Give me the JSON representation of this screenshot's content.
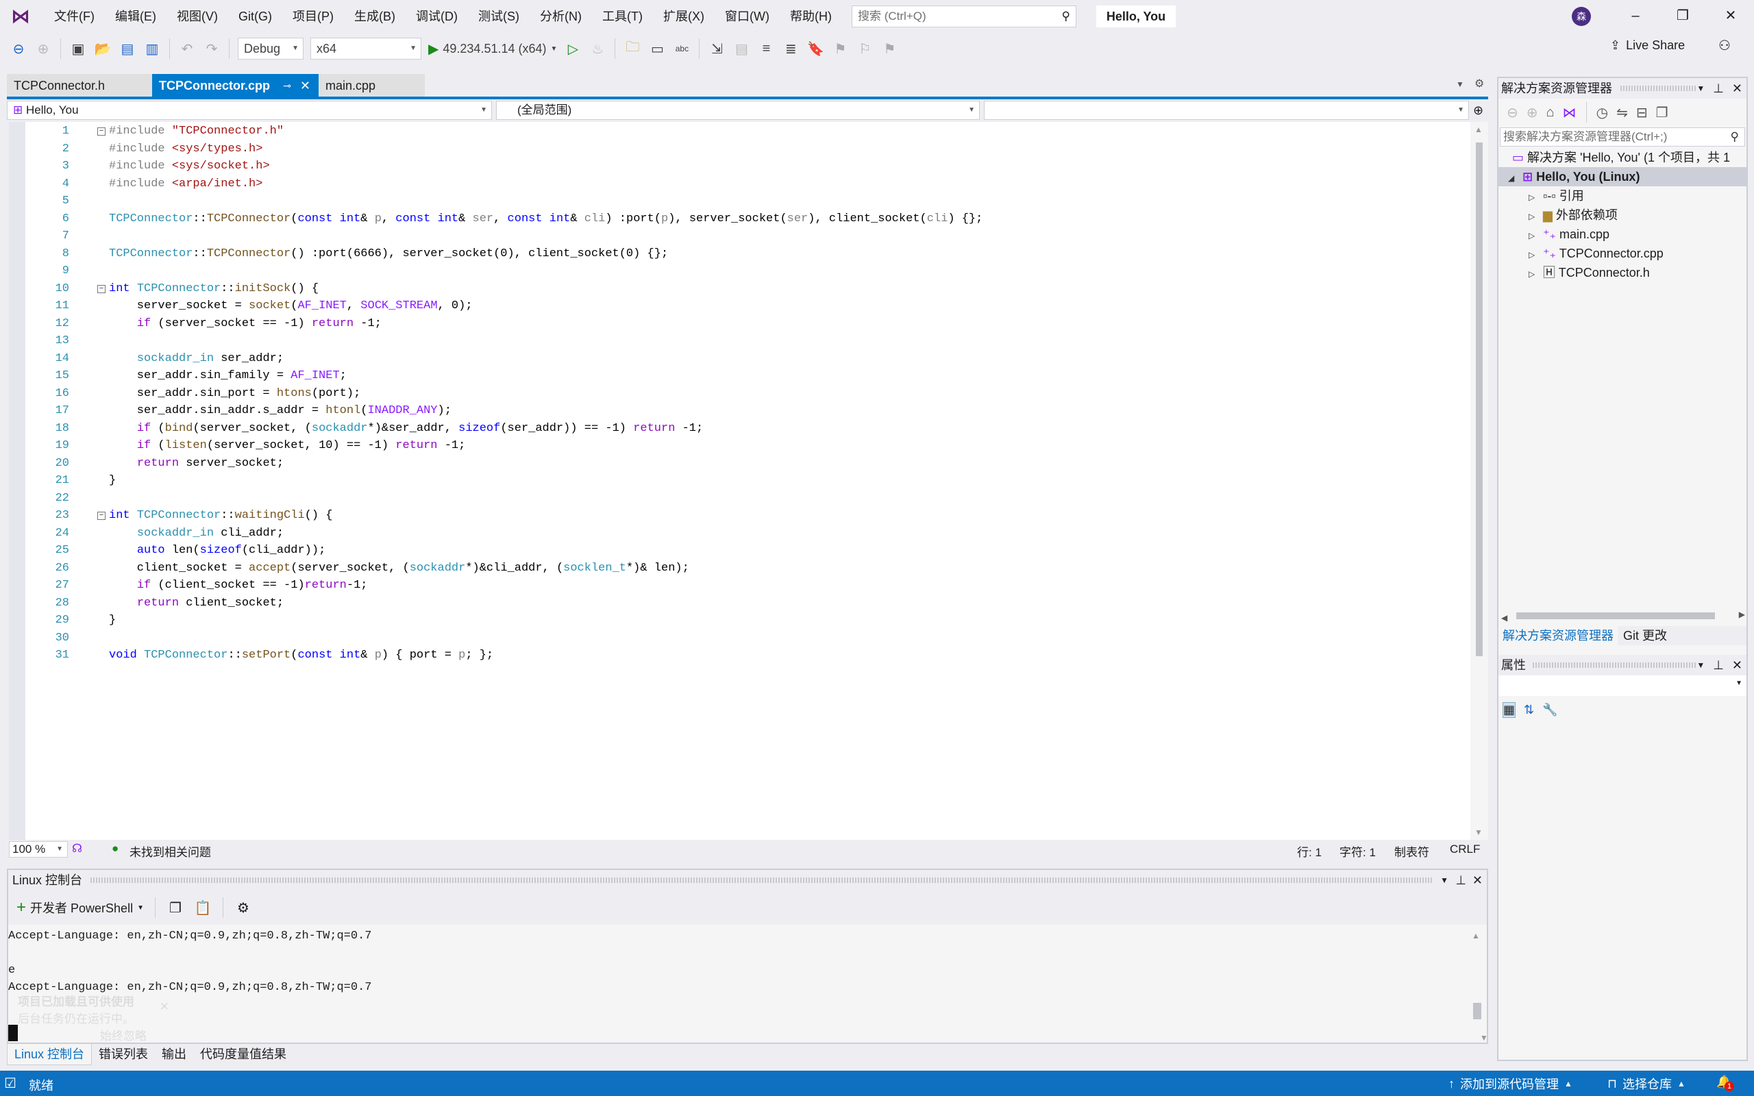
{
  "titlebar": {
    "menu": [
      "文件(F)",
      "编辑(E)",
      "视图(V)",
      "Git(G)",
      "项目(P)",
      "生成(B)",
      "调试(D)",
      "测试(S)",
      "分析(N)",
      "工具(T)",
      "扩展(X)",
      "窗口(W)",
      "帮助(H)"
    ],
    "search_placeholder": "搜索 (Ctrl+Q)",
    "solution_name": "Hello, You",
    "avatar": "森"
  },
  "toolbar": {
    "config": "Debug",
    "platform": "x64",
    "run_target": "49.234.51.14 (x64)",
    "live_share": "Live Share"
  },
  "tabs": [
    {
      "label": "TCPConnector.h",
      "active": false
    },
    {
      "label": "TCPConnector.cpp",
      "active": true
    },
    {
      "label": "main.cpp",
      "active": false
    }
  ],
  "navbar": {
    "project": "Hello, You",
    "scope": "(全局范围)",
    "member": ""
  },
  "editor": {
    "lines": [
      [
        [
          "#include ",
          "pp"
        ],
        [
          "\"TCPConnector.h\"",
          "str"
        ]
      ],
      [
        [
          "#include ",
          "pp"
        ],
        [
          "<sys/types.h>",
          "str"
        ]
      ],
      [
        [
          "#include ",
          "pp"
        ],
        [
          "<sys/socket.h>",
          "str"
        ]
      ],
      [
        [
          "#include ",
          "pp"
        ],
        [
          "<arpa/inet.h>",
          "str"
        ]
      ],
      [],
      [
        [
          "TCPConnector",
          "cls"
        ],
        [
          "::",
          ""
        ],
        [
          "TCPConnector",
          "fn"
        ],
        [
          "(",
          ""
        ],
        [
          "const int",
          "kw"
        ],
        [
          "& ",
          ""
        ],
        [
          "p",
          "prm"
        ],
        [
          ", ",
          ""
        ],
        [
          "const int",
          "kw"
        ],
        [
          "& ",
          ""
        ],
        [
          "ser",
          "prm"
        ],
        [
          ", ",
          ""
        ],
        [
          "const int",
          "kw"
        ],
        [
          "& ",
          ""
        ],
        [
          "cli",
          "prm"
        ],
        [
          ") :port(",
          ""
        ],
        [
          "p",
          "prm"
        ],
        [
          "), server_socket(",
          ""
        ],
        [
          "ser",
          "prm"
        ],
        [
          "), client_socket(",
          ""
        ],
        [
          "cli",
          "prm"
        ],
        [
          ") {};",
          ""
        ]
      ],
      [],
      [
        [
          "TCPConnector",
          "cls"
        ],
        [
          "::",
          ""
        ],
        [
          "TCPConnector",
          "fn"
        ],
        [
          "() :port(6666), server_socket(0), client_socket(0) {};",
          ""
        ]
      ],
      [],
      [
        [
          "int ",
          "kw"
        ],
        [
          "TCPConnector",
          "cls"
        ],
        [
          "::",
          ""
        ],
        [
          "initSock",
          "fn"
        ],
        [
          "() {",
          ""
        ]
      ],
      [
        [
          "    server_socket = ",
          ""
        ],
        [
          "socket",
          "fn"
        ],
        [
          "(",
          ""
        ],
        [
          "AF_INET",
          "mac"
        ],
        [
          ", ",
          ""
        ],
        [
          "SOCK_STREAM",
          "mac"
        ],
        [
          ", 0);",
          ""
        ]
      ],
      [
        [
          "    ",
          ""
        ],
        [
          "if",
          "ctl"
        ],
        [
          " (server_socket == -1) ",
          ""
        ],
        [
          "return",
          "ctl"
        ],
        [
          " -1;",
          ""
        ]
      ],
      [],
      [
        [
          "    ",
          ""
        ],
        [
          "sockaddr_in",
          "cls"
        ],
        [
          " ser_addr;",
          ""
        ]
      ],
      [
        [
          "    ser_addr.sin_family = ",
          ""
        ],
        [
          "AF_INET",
          "mac"
        ],
        [
          ";",
          ""
        ]
      ],
      [
        [
          "    ser_addr.sin_port = ",
          ""
        ],
        [
          "htons",
          "fn"
        ],
        [
          "(port);",
          ""
        ]
      ],
      [
        [
          "    ser_addr.sin_addr.s_addr = ",
          ""
        ],
        [
          "htonl",
          "fn"
        ],
        [
          "(",
          ""
        ],
        [
          "INADDR_ANY",
          "mac"
        ],
        [
          ");",
          ""
        ]
      ],
      [
        [
          "    ",
          ""
        ],
        [
          "if",
          "ctl"
        ],
        [
          " (",
          ""
        ],
        [
          "bind",
          "fn"
        ],
        [
          "(server_socket, (",
          ""
        ],
        [
          "sockaddr",
          "cls"
        ],
        [
          "*)&ser_addr, ",
          ""
        ],
        [
          "sizeof",
          "kw"
        ],
        [
          "(ser_addr)) == -1) ",
          ""
        ],
        [
          "return",
          "ctl"
        ],
        [
          " -1;",
          ""
        ]
      ],
      [
        [
          "    ",
          ""
        ],
        [
          "if",
          "ctl"
        ],
        [
          " (",
          ""
        ],
        [
          "listen",
          "fn"
        ],
        [
          "(server_socket, 10) == -1) ",
          ""
        ],
        [
          "return",
          "ctl"
        ],
        [
          " -1;",
          ""
        ]
      ],
      [
        [
          "    ",
          ""
        ],
        [
          "return",
          "ctl"
        ],
        [
          " server_socket;",
          ""
        ]
      ],
      [
        [
          "}",
          ""
        ]
      ],
      [],
      [
        [
          "int ",
          "kw"
        ],
        [
          "TCPConnector",
          "cls"
        ],
        [
          "::",
          ""
        ],
        [
          "waitingCli",
          "fn"
        ],
        [
          "() {",
          ""
        ]
      ],
      [
        [
          "    ",
          ""
        ],
        [
          "sockaddr_in",
          "cls"
        ],
        [
          " cli_addr;",
          ""
        ]
      ],
      [
        [
          "    ",
          ""
        ],
        [
          "auto",
          "kw"
        ],
        [
          " len(",
          ""
        ],
        [
          "sizeof",
          "kw"
        ],
        [
          "(cli_addr));",
          ""
        ]
      ],
      [
        [
          "    client_socket = ",
          ""
        ],
        [
          "accept",
          "fn"
        ],
        [
          "(server_socket, (",
          ""
        ],
        [
          "sockaddr",
          "cls"
        ],
        [
          "*)&cli_addr, (",
          ""
        ],
        [
          "socklen_t",
          "cls"
        ],
        [
          "*)& len);",
          ""
        ]
      ],
      [
        [
          "    ",
          ""
        ],
        [
          "if",
          "ctl"
        ],
        [
          " (client_socket == -1)",
          ""
        ],
        [
          "return",
          "ctl"
        ],
        [
          "-1;",
          ""
        ]
      ],
      [
        [
          "    ",
          ""
        ],
        [
          "return",
          "ctl"
        ],
        [
          " client_socket;",
          ""
        ]
      ],
      [
        [
          "}",
          ""
        ]
      ],
      [],
      [
        [
          "void ",
          "kw"
        ],
        [
          "TCPConnector",
          "cls"
        ],
        [
          "::",
          ""
        ],
        [
          "setPort",
          "fn"
        ],
        [
          "(",
          ""
        ],
        [
          "const int",
          "kw"
        ],
        [
          "& ",
          ""
        ],
        [
          "p",
          "prm"
        ],
        [
          ") { port = ",
          ""
        ],
        [
          "p",
          "prm"
        ],
        [
          "; };",
          ""
        ]
      ]
    ],
    "fold_lines": [
      1,
      10,
      23
    ]
  },
  "editor_status": {
    "zoom": "100 %",
    "issues": "未找到相关问题",
    "line": "行: 1",
    "char": "字符: 1",
    "indent": "制表符",
    "eol": "CRLF"
  },
  "bottom_panel": {
    "title": "Linux 控制台",
    "new_shell": "开发者 PowerShell",
    "console_lines": [
      "Accept-Language: en,zh-CN;q=0.9,zh;q=0.8,zh-TW;q=0.7",
      "",
      "e",
      "Accept-Language: en,zh-CN;q=0.9,zh;q=0.8,zh-TW;q=0.7"
    ],
    "toast_title": "项目已加载且可供使用",
    "toast_body": "后台任务仍在运行中。",
    "toast_action": "始终忽略",
    "tabs": [
      "Linux 控制台",
      "错误列表",
      "输出",
      "代码度量值结果"
    ]
  },
  "solution_explorer": {
    "title": "解决方案资源管理器",
    "search_placeholder": "搜索解决方案资源管理器(Ctrl+;)",
    "solution": "解决方案 'Hello, You' (1 个项目，共 1",
    "project": "Hello, You (Linux)",
    "items": [
      "引用",
      "外部依赖项",
      "main.cpp",
      "TCPConnector.cpp",
      "TCPConnector.h"
    ],
    "tabs": [
      "解决方案资源管理器",
      "Git 更改"
    ]
  },
  "properties": {
    "title": "属性"
  },
  "statusbar": {
    "ready": "就绪",
    "add_source_control": "添加到源代码管理",
    "select_repo": "选择仓库",
    "notifications": "1"
  }
}
